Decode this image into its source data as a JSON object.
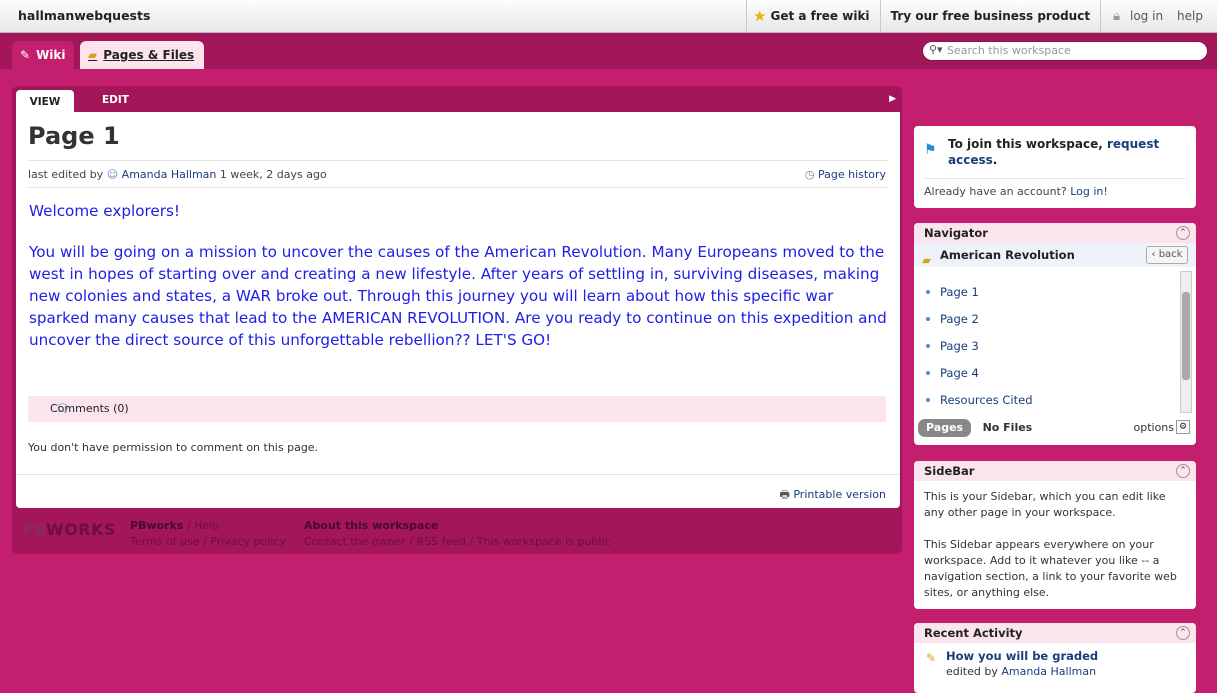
{
  "topbar": {
    "brand": "hallmanwebquests",
    "get_free_wiki": "Get a free wiki",
    "business": "Try our free business product",
    "login": "log in",
    "help": "help"
  },
  "tabs": {
    "wiki": "Wiki",
    "pages_files": "Pages & Files"
  },
  "search": {
    "placeholder": "Search this workspace"
  },
  "page": {
    "view_tab": "VIEW",
    "edit_tab": "EDIT",
    "title": "Page 1",
    "last_edited_prefix": "last edited by",
    "author": "Amanda Hallman",
    "edited_ago": "1 week, 2 days ago",
    "page_history": "Page history",
    "greeting": "Welcome explorers!",
    "paragraph": "You will be going on a mission to uncover the causes of the American Revolution. Many Europeans moved to the west in hopes of starting over and creating a new lifestyle.  After years of settling in, surviving diseases, making new colonies and states, a WAR broke out. Through this journey you will learn about how this specific war sparked many causes that lead to the AMERICAN REVOLUTION. Are you ready to continue on this expedition and uncover the direct source of this unforgettable rebellion?? LET'S GO!",
    "comments": "Comments (0)",
    "no_permission": "You don't have permission to comment on this page.",
    "printable": "Printable version"
  },
  "footer": {
    "logo_pb": "PB",
    "logo_works": "WORKS",
    "pbworks": "PBworks",
    "help": "Help",
    "terms": "Terms of use",
    "privacy": "Privacy policy",
    "about": "About this workspace",
    "contact": "Contact the owner",
    "rss": "RSS feed",
    "public": "This workspace is public"
  },
  "join": {
    "text": "To join this workspace,",
    "link": "request access",
    "period": ".",
    "already": "Already have an account?",
    "login_link": "Log in",
    "excl": "!"
  },
  "navigator": {
    "title": "Navigator",
    "folder": "American Revolution",
    "back": "back",
    "items": [
      "Page 1",
      "Page 2",
      "Page 3",
      "Page 4",
      "Resources Cited"
    ],
    "pages": "Pages",
    "no_files": "No Files",
    "options": "options"
  },
  "sidebar": {
    "title": "SideBar",
    "p1": "This is your Sidebar, which you can edit like any other page in your workspace.",
    "p2": "This Sidebar appears everywhere on your workspace. Add to it whatever you like -- a navigation section, a link to your favorite web sites, or anything else."
  },
  "recent": {
    "title": "Recent Activity",
    "item": "How you will be graded",
    "edited_by": "edited by",
    "user": "Amanda Hallman"
  }
}
